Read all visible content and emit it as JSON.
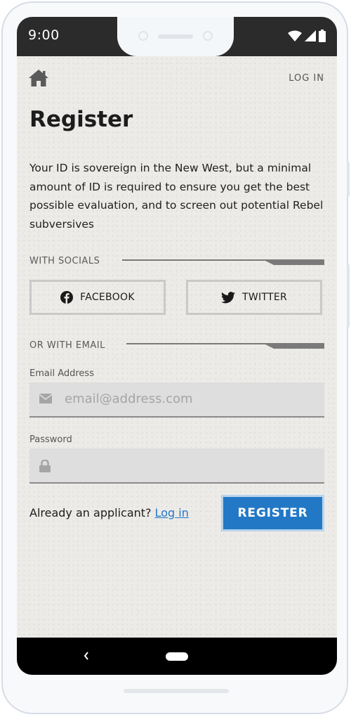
{
  "status_bar": {
    "time": "9:00",
    "icons": [
      "wifi-icon",
      "signal-icon",
      "battery-icon"
    ]
  },
  "header": {
    "home_icon": "home-icon",
    "login_link": "LOG IN"
  },
  "page": {
    "title": "Register",
    "intro": "Your ID is sovereign in the New West, but a minimal amount of ID is required to ensure you get the best possible evaluation, and to screen out potential Rebel subversives"
  },
  "socials": {
    "label": "WITH SOCIALS",
    "facebook_label": "FACEBOOK",
    "twitter_label": "TWITTER"
  },
  "email_section": {
    "label": "OR WITH EMAIL",
    "email_label": "Email Address",
    "email_placeholder": "email@address.com",
    "password_label": "Password",
    "password_value": ""
  },
  "footer": {
    "already_text": "Already an applicant?",
    "login_link": "Log in",
    "register_label": "REGISTER"
  },
  "colors": {
    "accent": "#2378c6",
    "background": "#ecebe8",
    "status_bar": "#2b2b2b"
  }
}
